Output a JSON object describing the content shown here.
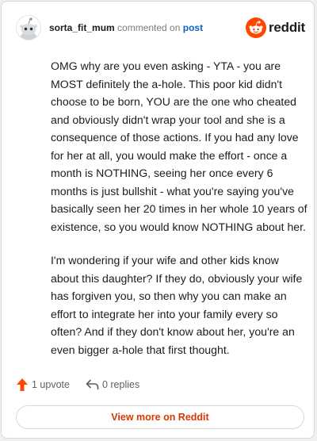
{
  "header": {
    "username": "sorta_fit_mum",
    "commented_on": "commented on",
    "post_link": "post",
    "logo_text": "reddit",
    "logo_icon": "reddit-snoo-icon",
    "avatar_icon": "snoo-avatar-icon"
  },
  "comment": {
    "paragraphs": [
      "OMG why are you even asking - YTA - you are MOST definitely the a-hole. This poor kid didn't choose to be born, YOU are the one who cheated and obviously didn't wrap your tool and she is a consequence of those actions. If you had any love for her at all, you would make the effort - once a month is NOTHING, seeing her once every 6 months is just bullshit - what you're saying you've basically seen her 20 times in her whole 10 years of existence, so you would know NOTHING about her.",
      "I'm wondering if your wife and other kids know about this daughter? If they do, obviously your wife has forgiven you, so then why you can make an effort to integrate her into your family every so often? And if they don't know about her, you're an even bigger a-hole that first thought."
    ]
  },
  "actions": {
    "upvote_label": "1 upvote",
    "upvote_icon": "upvote-arrow-icon",
    "replies_label": "0 replies",
    "replies_icon": "reply-arrow-icon"
  },
  "footer": {
    "view_more_label": "View more on Reddit"
  },
  "colors": {
    "brand": "#ff4500",
    "link": "#0a63c9",
    "cta_text": "#d93900"
  }
}
